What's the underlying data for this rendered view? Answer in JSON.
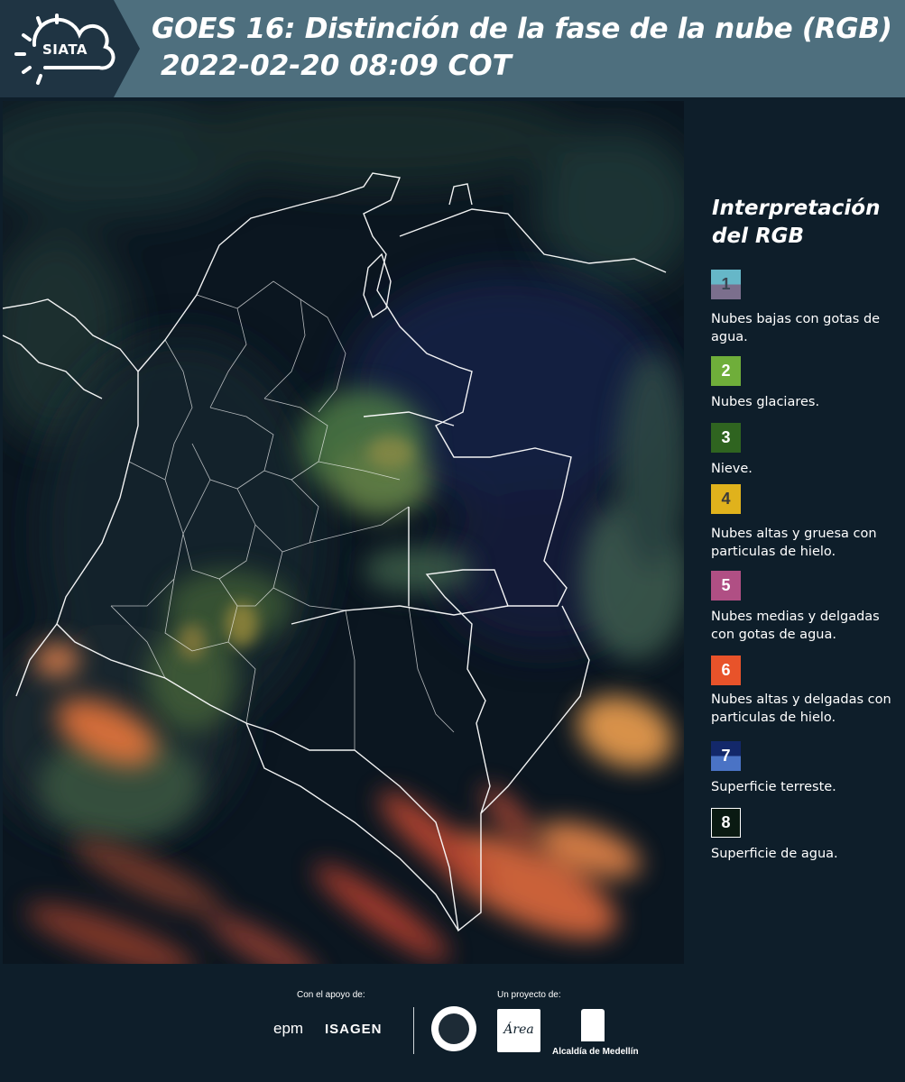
{
  "header": {
    "logo_text": "SIATA",
    "title_line1": "GOES 16: Distinción de la fase de la nube (RGB)",
    "title_line2": "2022-02-20 08:09 COT"
  },
  "legend": {
    "title_line1": "Interpretación",
    "title_line2": "del RGB",
    "items": [
      {
        "num": "1",
        "label": "Nubes bajas con gotas de agua.",
        "color_top": "#66b7c8",
        "color_bottom": "#7b6f8d",
        "text_color": "#3a4653"
      },
      {
        "num": "2",
        "label": "Nubes glaciares.",
        "color": "#6fae3a",
        "text_color": "#ffffff"
      },
      {
        "num": "3",
        "label": "Nieve.",
        "color": "#2f6420",
        "text_color": "#ffffff"
      },
      {
        "num": "4",
        "label": "Nubes altas y gruesa con particulas de hielo.",
        "color": "#e0b21c",
        "text_color": "#3a3a3a"
      },
      {
        "num": "5",
        "label": "Nubes medias y delgadas con gotas de agua.",
        "color": "#b04f84",
        "text_color": "#ffffff"
      },
      {
        "num": "6",
        "label": "Nubes altas y delgadas con particulas de hielo.",
        "color": "#e8532a",
        "text_color": "#ffffff"
      },
      {
        "num": "7",
        "label": "Superficie terreste.",
        "color_top": "#13286a",
        "color_bottom": "#4a73c5",
        "text_color": "#ffffff"
      },
      {
        "num": "8",
        "label": "Superficie de agua.",
        "color": "#0a1a12",
        "text_color": "#ffffff",
        "border": "#ffffff"
      }
    ]
  },
  "footer": {
    "support_label": "Con el apoyo de:",
    "project_label": "Un proyecto de:",
    "sponsor1": "epm",
    "sponsor2": "ISAGEN",
    "area_logo_text": "Área",
    "alcaldia": "Alcaldía de Medellín"
  },
  "colors": {
    "header_bg": "#4e6f7e",
    "logo_bg": "#1f3443",
    "page_bg": "#0e1e2a"
  }
}
